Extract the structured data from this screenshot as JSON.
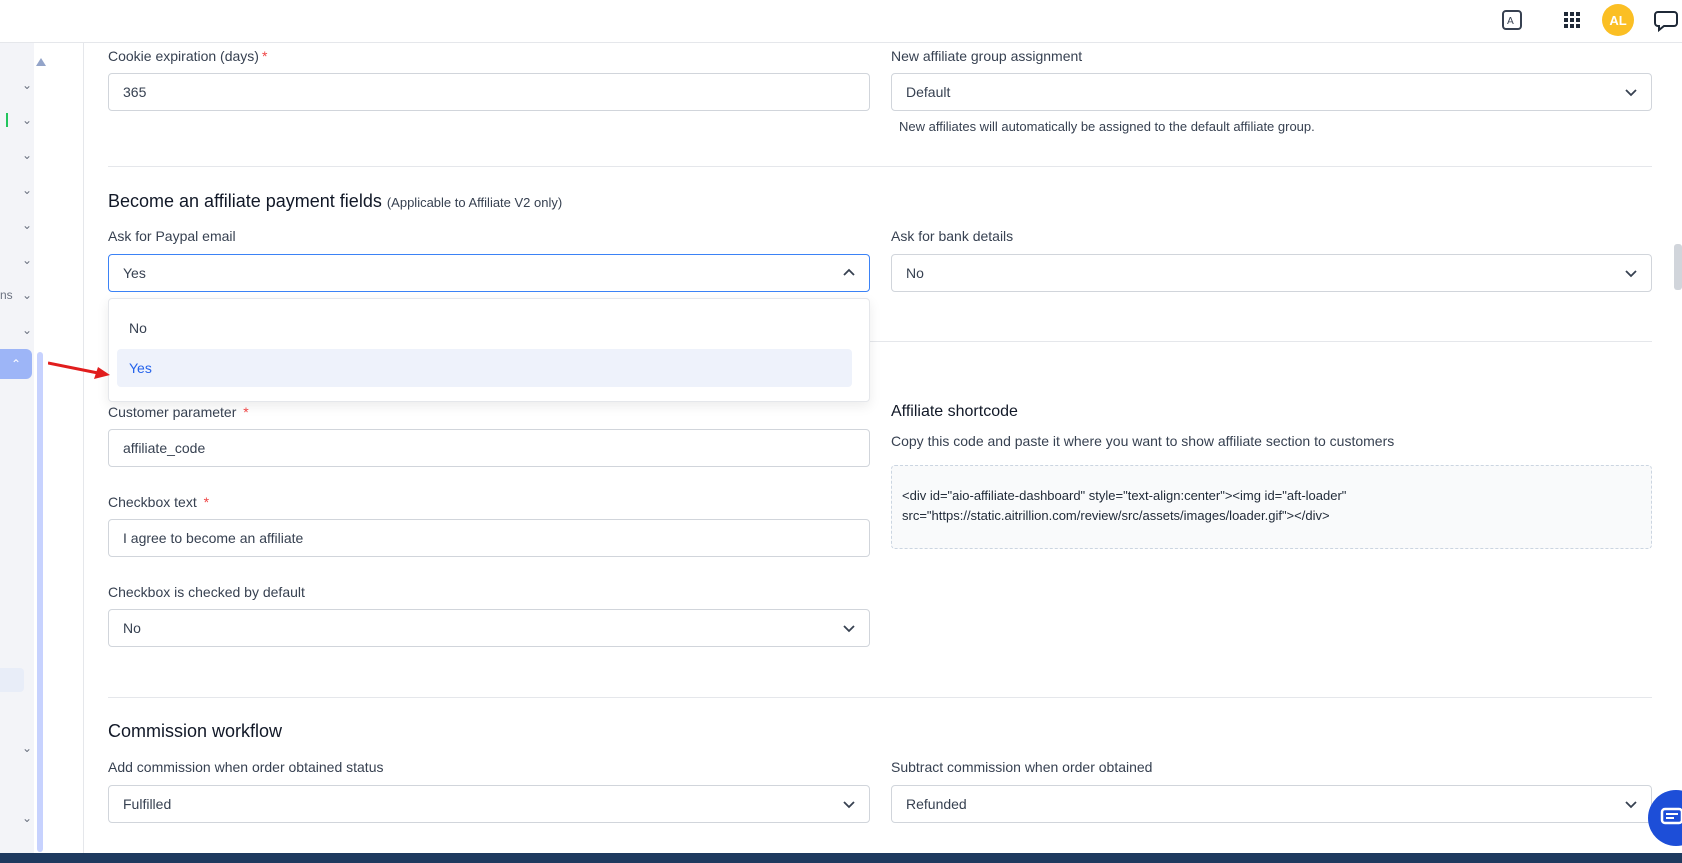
{
  "topbar": {
    "avatar_initials": "AL"
  },
  "sidebar": {
    "partial_label": "ns"
  },
  "general": {
    "cookie_label": "Cookie expiration (days)",
    "cookie_value": "365",
    "group_label": "New affiliate group assignment",
    "group_value": "Default",
    "group_help": "New affiliates will automatically be assigned to the default affiliate group."
  },
  "payment": {
    "title": "Become an affiliate payment fields",
    "title_note": "(Applicable to Affiliate V2 only)",
    "paypal_label": "Ask for Paypal email",
    "paypal_value": "Yes",
    "paypal_options": [
      "No",
      "Yes"
    ],
    "bank_label": "Ask for bank details",
    "bank_value": "No"
  },
  "customer": {
    "param_label": "Customer parameter",
    "param_value": "affiliate_code",
    "checkbox_text_label": "Checkbox text",
    "checkbox_text_value": "I agree to become an affiliate",
    "checked_default_label": "Checkbox is checked by default",
    "checked_default_value": "No"
  },
  "shortcode": {
    "title": "Affiliate shortcode",
    "help": "Copy this code and paste it where you want to show affiliate section to customers",
    "line1": "<div id=\"aio-affiliate-dashboard\" style=\"text-align:center\"><img id=\"aft-loader\"",
    "line2": "src=\"https://static.aitrillion.com/review/src/assets/images/loader.gif\"></div>"
  },
  "commission": {
    "title": "Commission workflow",
    "add_label": "Add commission when order obtained status",
    "add_value": "Fulfilled",
    "subtract_label": "Subtract commission when order obtained",
    "subtract_value": "Refunded"
  },
  "colors": {
    "accent": "#2563eb",
    "required": "#ef4444",
    "avatar": "#fbbf24",
    "annotation_arrow": "#e11d1d"
  }
}
